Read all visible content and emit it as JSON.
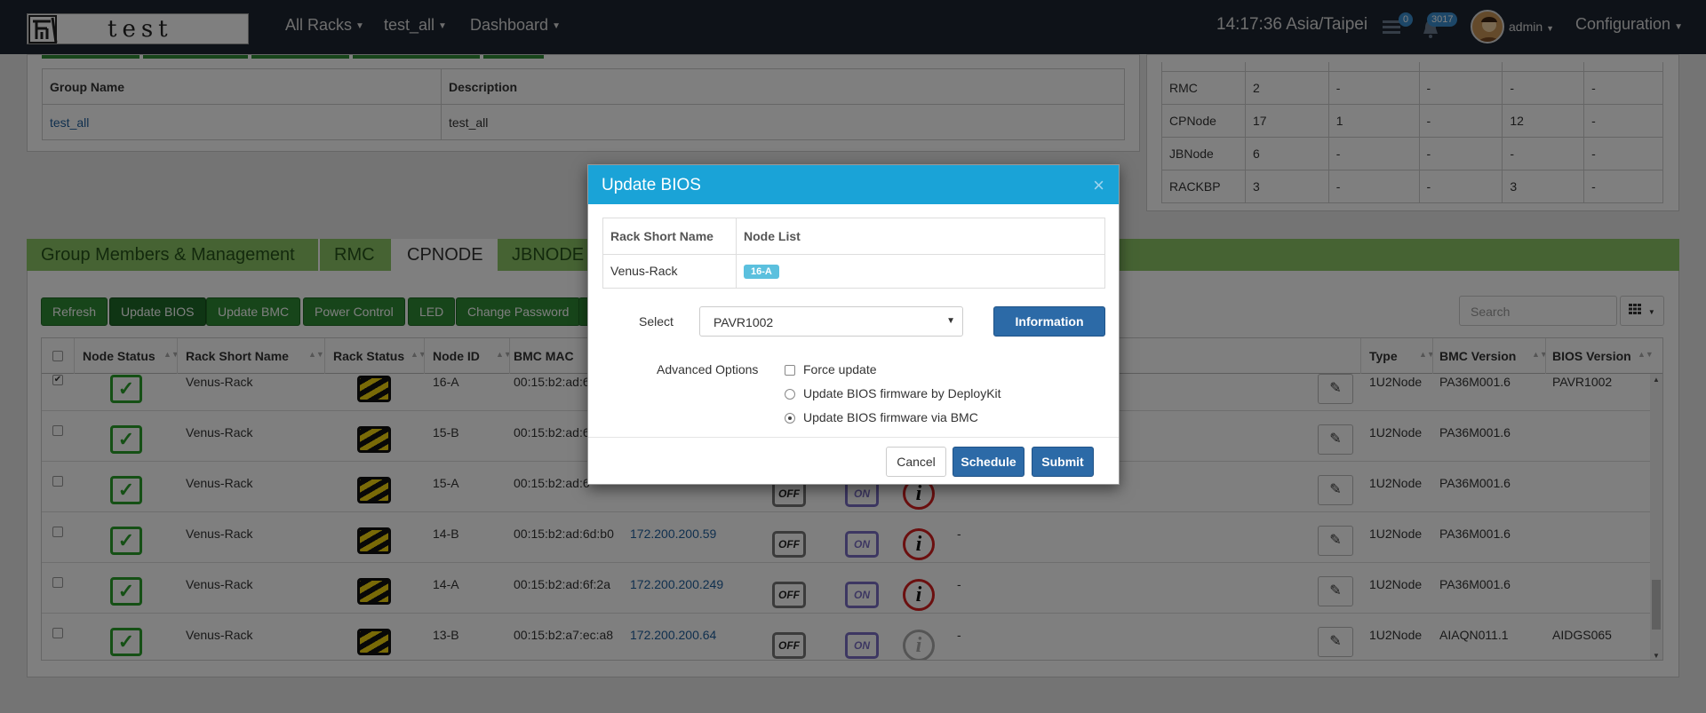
{
  "navbar": {
    "logo_text": "test",
    "menus": [
      "All Racks",
      "test_all",
      "Dashboard"
    ],
    "clock": "14:17:36 Asia/Taipei",
    "messages_count": "0",
    "alerts_count": "3017",
    "user": "admin",
    "configuration": "Configuration"
  },
  "group_table": {
    "headers": [
      "Group Name",
      "Description"
    ],
    "row": {
      "name": "test_all",
      "description": "test_all"
    }
  },
  "summary_table": {
    "rows": [
      [
        "RMC",
        "2",
        "-",
        "-",
        "-",
        "-"
      ],
      [
        "CPNode",
        "17",
        "1",
        "-",
        "12",
        "-"
      ],
      [
        "JBNode",
        "6",
        "-",
        "-",
        "-",
        "-"
      ],
      [
        "RACKBP",
        "3",
        "-",
        "-",
        "3",
        "-"
      ]
    ]
  },
  "tabs": [
    "Group Members & Management",
    "RMC",
    "CPNODE",
    "JBNODE"
  ],
  "toolbar": {
    "buttons": [
      "Refresh",
      "Update BIOS",
      "Update BMC",
      "Power Control",
      "LED",
      "Change Password"
    ],
    "search_placeholder": "Search"
  },
  "grid": {
    "headers": [
      "Node Status",
      "Rack Short Name",
      "Rack Status",
      "Node ID",
      "BMC MAC",
      "Type",
      "BMC Version",
      "BIOS Version"
    ],
    "rows": [
      {
        "checked": true,
        "rack": "Venus-Rack",
        "node": "16-A",
        "mac": "00:15:b2:ad:6",
        "ip": "",
        "desc": "",
        "type": "1U2Node",
        "bmc": "PA36M001.6",
        "bios": "PAVR1002",
        "info": "red"
      },
      {
        "checked": false,
        "rack": "Venus-Rack",
        "node": "15-B",
        "mac": "00:15:b2:ad:6",
        "ip": "",
        "desc": "",
        "type": "1U2Node",
        "bmc": "PA36M001.6",
        "bios": "",
        "info": "red"
      },
      {
        "checked": false,
        "rack": "Venus-Rack",
        "node": "15-A",
        "mac": "00:15:b2:ad:6",
        "ip": "",
        "desc": "",
        "type": "1U2Node",
        "bmc": "PA36M001.6",
        "bios": "",
        "info": "red"
      },
      {
        "checked": false,
        "rack": "Venus-Rack",
        "node": "14-B",
        "mac": "00:15:b2:ad:6d:b0",
        "ip": "172.200.200.59",
        "desc": "-",
        "type": "1U2Node",
        "bmc": "PA36M001.6",
        "bios": "",
        "info": "red"
      },
      {
        "checked": false,
        "rack": "Venus-Rack",
        "node": "14-A",
        "mac": "00:15:b2:ad:6f:2a",
        "ip": "172.200.200.249",
        "desc": "-",
        "type": "1U2Node",
        "bmc": "PA36M001.6",
        "bios": "",
        "info": "red"
      },
      {
        "checked": false,
        "rack": "Venus-Rack",
        "node": "13-B",
        "mac": "00:15:b2:a7:ec:a8",
        "ip": "172.200.200.64",
        "desc": "-",
        "type": "1U2Node",
        "bmc": "AIAQN011.1",
        "bios": "AIDGS065",
        "info": "grey"
      }
    ],
    "power_off": "OFF",
    "power_on": "ON"
  },
  "modal": {
    "title": "Update BIOS",
    "close": "×",
    "table_headers": [
      "Rack Short Name",
      "Node List"
    ],
    "rack_name": "Venus-Rack",
    "node_badge": "16-A",
    "select_label": "Select",
    "select_value": "PAVR1002",
    "information_button": "Information",
    "advanced_label": "Advanced Options",
    "options": [
      "Force update",
      "Update BIOS firmware by DeployKit",
      "Update BIOS firmware via BMC"
    ],
    "cancel": "Cancel",
    "schedule": "Schedule",
    "submit": "Submit"
  }
}
